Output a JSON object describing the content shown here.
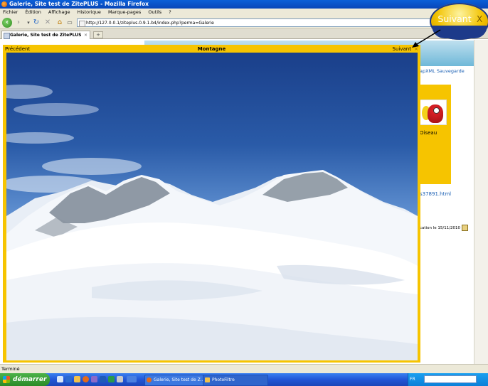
{
  "window": {
    "title": "Galerie, Site test de ZitePLUS - Mozilla Firefox"
  },
  "menu": [
    "Fichier",
    "Édition",
    "Affichage",
    "Historique",
    "Marque-pages",
    "Outils",
    "?"
  ],
  "address": {
    "url": "http://127.0.0.1/ziteplus.0.9.1.b4/index.php?perma=Galerie"
  },
  "tab": {
    "title": "Galerie, Site test de ZitePLUS",
    "close": "×",
    "new_tab": "+"
  },
  "page": {
    "nav_text": "apXML  Sauvegarde",
    "thumb_label": "Oiseau",
    "link_text": "s37891.html",
    "pub_text": "cation le 15/11/2010"
  },
  "lightbox": {
    "prev_label": "Précédent",
    "title": "Montagne",
    "next_label": "Suivant",
    "close_label": "×"
  },
  "status": {
    "text": "Terminé"
  },
  "taskbar": {
    "start_label": "démarrer",
    "tasks": [
      {
        "label": "Galerie, Site test de Z..."
      },
      {
        "label": "PhotoFiltre"
      }
    ],
    "tray_lang": "FR"
  },
  "callout": {
    "label": "Suivant",
    "close": "X"
  },
  "colors": {
    "lightbox_frame": "#f6c400",
    "callout_fill": "#f2c200",
    "callout_band": "#1d3a8a"
  }
}
